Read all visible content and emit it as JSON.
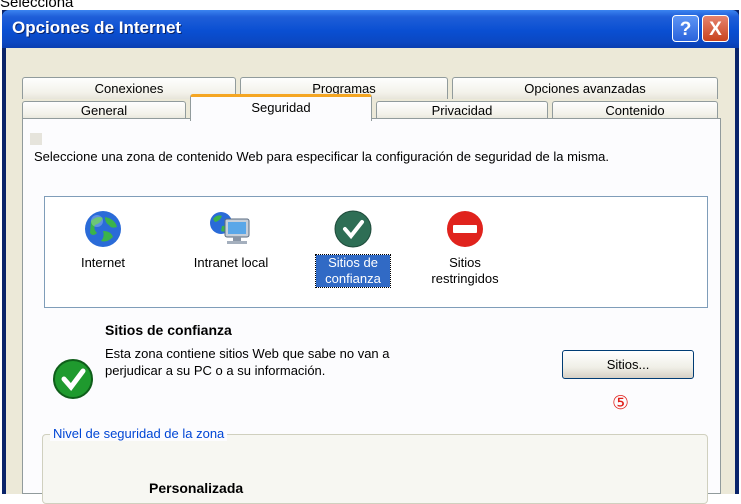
{
  "caption": "Selecciona",
  "window": {
    "title": "Opciones de Internet",
    "help_label": "?",
    "close_label": "X"
  },
  "tabs": {
    "row1": [
      "Conexiones",
      "Programas",
      "Opciones avanzadas"
    ],
    "row2": [
      "General",
      "Seguridad",
      "Privacidad",
      "Contenido"
    ],
    "active": "Seguridad"
  },
  "security": {
    "description": "Seleccione una zona de contenido Web para especificar la configuración de seguridad de la misma.",
    "zones": [
      {
        "label": "Internet",
        "icon": "globe-icon"
      },
      {
        "label": "Intranet local",
        "icon": "intranet-computer-icon"
      },
      {
        "label": "Sitios de confianza",
        "icon": "trusted-check-icon",
        "selected": true
      },
      {
        "label": "Sitios restringidos",
        "icon": "restricted-no-entry-icon"
      }
    ],
    "selected_zone_title": "Sitios de confianza",
    "selected_zone_description": "Esta zona contiene sitios Web que sabe no van a perjudicar a su PC o a su información.",
    "sites_button": "Sitios...",
    "step_marker": "⑤",
    "security_level_group": "Nivel de seguridad de la zona",
    "security_level": "Personalizada"
  }
}
